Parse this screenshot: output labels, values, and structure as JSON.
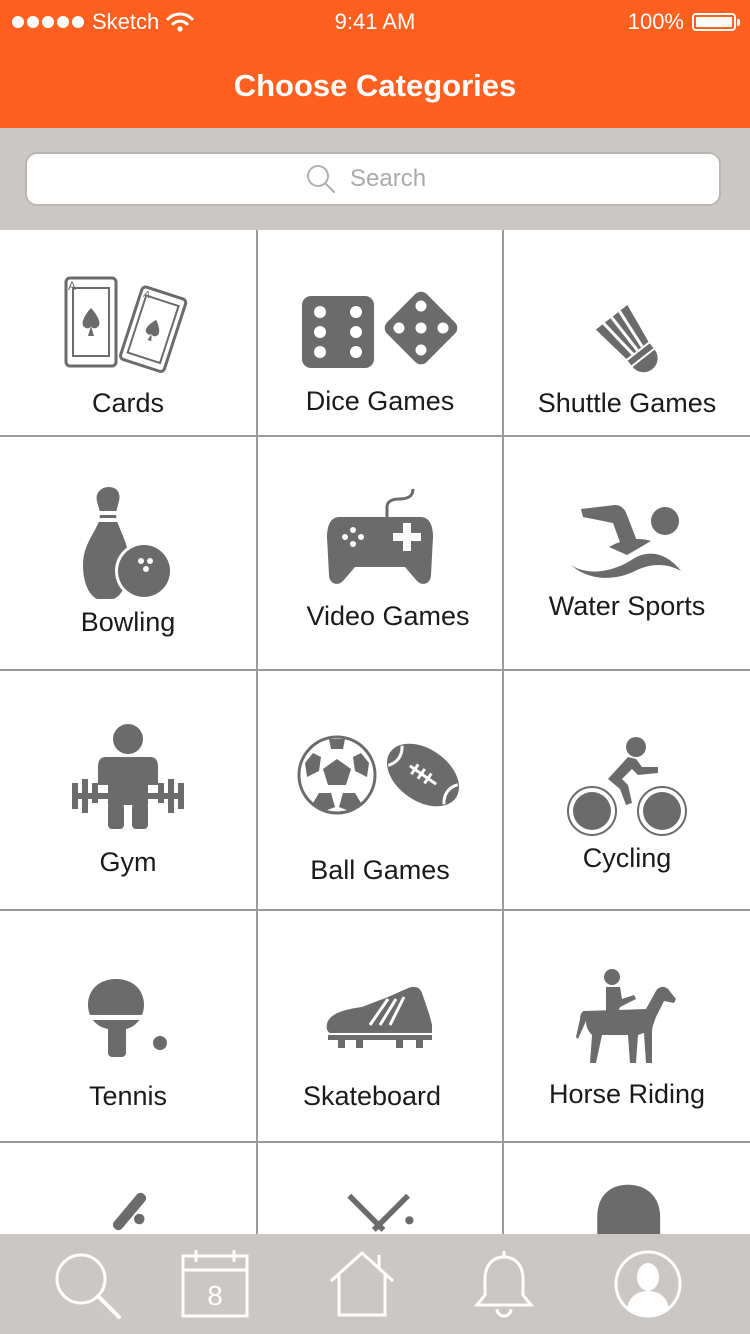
{
  "status_bar": {
    "carrier": "Sketch",
    "time": "9:41 AM",
    "battery": "100%"
  },
  "header": {
    "title": "Choose Categories"
  },
  "search": {
    "placeholder": "Search"
  },
  "categories": [
    {
      "label": "Cards",
      "icon": "playing-cards-icon"
    },
    {
      "label": "Dice Games",
      "icon": "dice-icon"
    },
    {
      "label": "Shuttle Games",
      "icon": "shuttlecock-icon"
    },
    {
      "label": "Bowling",
      "icon": "bowling-icon"
    },
    {
      "label": "Video Games",
      "icon": "gamepad-icon"
    },
    {
      "label": "Water Sports",
      "icon": "swimmer-icon"
    },
    {
      "label": "Gym",
      "icon": "weightlifter-icon"
    },
    {
      "label": "Ball Games",
      "icon": "balls-icon"
    },
    {
      "label": "Cycling",
      "icon": "cyclist-icon"
    },
    {
      "label": "Tennis",
      "icon": "table-tennis-icon"
    },
    {
      "label": "Skateboard",
      "icon": "sport-shoe-icon"
    },
    {
      "label": "Horse Riding",
      "icon": "horse-rider-icon"
    }
  ],
  "tab_bar": {
    "calendar_day": "8",
    "items": [
      "search-icon",
      "calendar-icon",
      "home-icon",
      "bell-icon",
      "profile-icon"
    ]
  },
  "colors": {
    "accent": "#FF5F1F",
    "bar_gray": "#CAC7C4",
    "icon_gray": "#6B6B6B",
    "grid_line": "#9B9B9B"
  }
}
